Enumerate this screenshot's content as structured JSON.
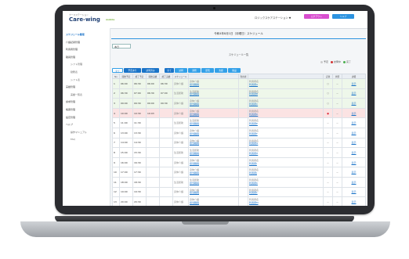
{
  "app": {
    "logo_sub": "ナースステーション",
    "logo": "Care-wing",
    "logo_tag": "mobile",
    "station": "ロジックスケアステーション ▼",
    "btn_account": "ログアウト",
    "btn_help": "ヘルプ"
  },
  "sidebar": {
    "items": [
      {
        "label": "スケジュール管理",
        "sub": false,
        "active": true
      },
      {
        "label": "介護記録管理",
        "sub": false,
        "active": false
      },
      {
        "label": "利用者管理",
        "sub": false,
        "active": false
      },
      {
        "label": "職員管理",
        "sub": false,
        "active": false
      },
      {
        "label": "シフト管理",
        "sub": true,
        "active": false
      },
      {
        "label": "勤務表",
        "sub": true,
        "active": false
      },
      {
        "label": "シフト表",
        "sub": true,
        "active": false
      },
      {
        "label": "実績管理",
        "sub": false,
        "active": false
      },
      {
        "label": "実績一覧表",
        "sub": true,
        "active": false
      },
      {
        "label": "請求管理",
        "sub": false,
        "active": false
      },
      {
        "label": "帳票管理",
        "sub": false,
        "active": false
      },
      {
        "label": "設定管理",
        "sub": false,
        "active": false
      },
      {
        "label": "ヘルプ",
        "sub": false,
        "active": false
      },
      {
        "label": "操作マニュアル",
        "sub": true,
        "active": false
      },
      {
        "label": "FAQ",
        "sub": true,
        "active": false
      }
    ]
  },
  "main": {
    "page_title": "令和4年8月1日（月曜日）スケジュール",
    "select_value": "本日",
    "table_title": "スケジュール一覧",
    "legend": [
      {
        "label": "予定",
        "color": "#cccccc"
      },
      {
        "label": "訪問中",
        "color": "#d23333"
      },
      {
        "label": "完了",
        "color": "#4caf50"
      }
    ],
    "filters": [
      "全て",
      "予定あり",
      "訪問済み",
      "全て",
      "訪問",
      "通所",
      "居宅",
      "支援",
      "施設"
    ],
    "columns": [
      "No",
      "開始予定",
      "終了予定",
      "開始実績",
      "終了実績",
      "スケジュール",
      "",
      "利用者",
      "",
      "記録",
      "状態",
      "詳細"
    ]
  },
  "rows": [
    {
      "no": "1",
      "start": "06:00",
      "end": "06:30",
      "astart": "06:00",
      "aend": "06:30",
      "svc": "身体介護",
      "staff": "担当職員",
      "client": "利用者A",
      "cname": "利用者名",
      "rec": "○",
      "st": "－",
      "detail": "表示",
      "state": "done"
    },
    {
      "no": "2",
      "start": "06:30",
      "end": "07:00",
      "astart": "06:30",
      "aend": "07:00",
      "svc": "生活援助",
      "staff": "担当職員",
      "client": "利用者B",
      "cname": "利用者名",
      "rec": "○",
      "st": "－",
      "detail": "表示",
      "state": "done"
    },
    {
      "no": "3",
      "start": "09:00",
      "end": "09:30",
      "astart": "09:00",
      "aend": "09:30",
      "svc": "身体介護",
      "staff": "担当職員",
      "client": "利用者C",
      "cname": "利用者名",
      "rec": "○",
      "st": "－",
      "detail": "表示",
      "state": "done"
    },
    {
      "no": "4",
      "start": "10:00",
      "end": "10:30",
      "astart": "10:03",
      "aend": "",
      "svc": "身体介護",
      "staff": "担当職員",
      "client": "利用者D",
      "cname": "利用者名",
      "rec": "●",
      "st": "－",
      "detail": "表示",
      "state": "alert"
    },
    {
      "no": "5",
      "start": "11:00",
      "end": "11:30",
      "astart": "",
      "aend": "",
      "svc": "生活援助",
      "staff": "担当職員",
      "client": "利用者E",
      "cname": "利用者名",
      "rec": "－",
      "st": "－",
      "detail": "表示",
      "state": "plain"
    },
    {
      "no": "6",
      "start": "13:00",
      "end": "13:30",
      "astart": "",
      "aend": "",
      "svc": "身体介護",
      "staff": "担当職員",
      "client": "利用者F",
      "cname": "利用者名",
      "rec": "－",
      "st": "－",
      "detail": "表示",
      "state": "plain"
    },
    {
      "no": "7",
      "start": "14:00",
      "end": "14:30",
      "astart": "",
      "aend": "",
      "svc": "身体介護",
      "staff": "担当職員",
      "client": "利用者G",
      "cname": "利用者名",
      "rec": "－",
      "st": "－",
      "detail": "表示",
      "state": "plain"
    },
    {
      "no": "8",
      "start": "15:00",
      "end": "15:30",
      "astart": "",
      "aend": "",
      "svc": "生活援助",
      "staff": "担当職員",
      "client": "利用者H",
      "cname": "利用者名",
      "rec": "－",
      "st": "－",
      "detail": "表示",
      "state": "plain"
    },
    {
      "no": "9",
      "start": "16:00",
      "end": "16:30",
      "astart": "",
      "aend": "",
      "svc": "身体介護",
      "staff": "担当職員",
      "client": "利用者I",
      "cname": "利用者名",
      "rec": "－",
      "st": "－",
      "detail": "表示",
      "state": "plain"
    },
    {
      "no": "10",
      "start": "17:00",
      "end": "17:30",
      "astart": "",
      "aend": "",
      "svc": "身体介護",
      "staff": "担当職員",
      "client": "利用者J",
      "cname": "利用者名",
      "rec": "－",
      "st": "－",
      "detail": "表示",
      "state": "plain"
    },
    {
      "no": "11",
      "start": "18:00",
      "end": "18:30",
      "astart": "",
      "aend": "",
      "svc": "生活援助",
      "staff": "担当職員",
      "client": "利用者K",
      "cname": "利用者名",
      "rec": "－",
      "st": "－",
      "detail": "表示",
      "state": "plain"
    },
    {
      "no": "12",
      "start": "19:00",
      "end": "19:30",
      "astart": "",
      "aend": "",
      "svc": "身体介護",
      "staff": "担当職員",
      "client": "利用者L",
      "cname": "利用者名",
      "rec": "－",
      "st": "－",
      "detail": "表示",
      "state": "plain"
    },
    {
      "no": "13",
      "start": "20:00",
      "end": "20:30",
      "astart": "",
      "aend": "",
      "svc": "身体介護",
      "staff": "担当職員",
      "client": "利用者M",
      "cname": "利用者名",
      "rec": "－",
      "st": "－",
      "detail": "表示",
      "state": "plain"
    },
    {
      "no": "14",
      "start": "21:00",
      "end": "21:30",
      "astart": "",
      "aend": "",
      "svc": "生活援助",
      "staff": "担当職員",
      "client": "利用者N",
      "cname": "利用者名",
      "rec": "－",
      "st": "－",
      "detail": "表示",
      "state": "plain"
    }
  ]
}
